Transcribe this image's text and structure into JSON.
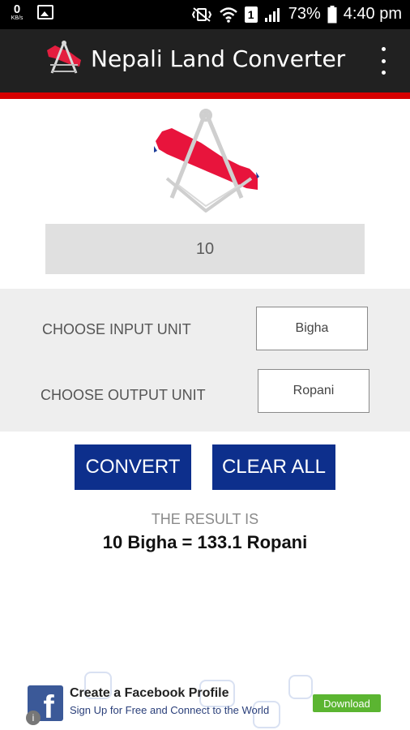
{
  "status_bar": {
    "kbs_value": "0",
    "kbs_unit": "KB/s",
    "battery": "73%",
    "time": "4:40 pm",
    "sim_number": "1"
  },
  "app_bar": {
    "title": "Nepali Land Converter"
  },
  "input": {
    "value": "10"
  },
  "units": {
    "input_label": "CHOOSE INPUT UNIT",
    "input_value": "Bigha",
    "output_label": "CHOOSE OUTPUT UNIT",
    "output_value": "Ropani"
  },
  "buttons": {
    "convert": "CONVERT",
    "clear_all": "CLEAR ALL"
  },
  "result": {
    "label": "THE RESULT IS",
    "text": "10 Bigha = 133.1 Ropani"
  },
  "ad": {
    "title": "Create a Facebook Profile",
    "subtitle": "Sign Up for Free and Connect to the World",
    "button": "Download",
    "brand_letter": "f",
    "info_icon_text": "i"
  },
  "colors": {
    "app_bar": "#212121",
    "accent_red": "#d50000",
    "button_blue": "#0d2f8c",
    "panel_gray": "#eeeeee",
    "input_gray": "#e0e0e0"
  }
}
